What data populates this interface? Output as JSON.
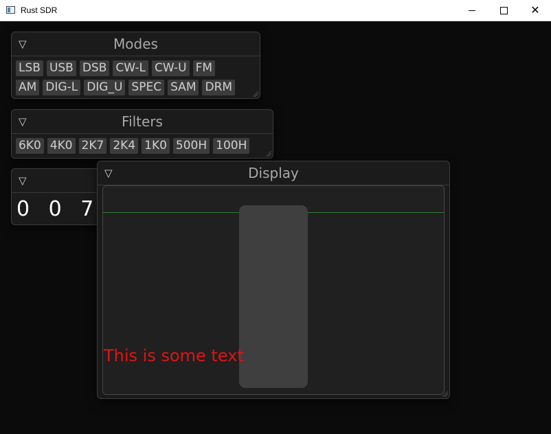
{
  "window": {
    "title": "Rust SDR",
    "minimize_glyph": "",
    "close_glyph": "✕"
  },
  "modes": {
    "title": "Modes",
    "collapse_glyph": "▽",
    "row1": [
      "LSB",
      "USB",
      "DSB",
      "CW-L",
      "CW-U",
      "FM"
    ],
    "row2": [
      "AM",
      "DIG-L",
      "DIG_U",
      "SPEC",
      "SAM",
      "DRM"
    ]
  },
  "filters": {
    "title": "Filters",
    "collapse_glyph": "▽",
    "items": [
      "6K0",
      "4K0",
      "2K7",
      "2K4",
      "1K0",
      "500H",
      "100H"
    ]
  },
  "frequency": {
    "collapse_glyph": "▽",
    "digits": "0 0 7 -"
  },
  "display": {
    "title": "Display",
    "collapse_glyph": "▽",
    "text": "This is some text",
    "text_color": "#e01414",
    "line_color": "#2f7d2f"
  }
}
